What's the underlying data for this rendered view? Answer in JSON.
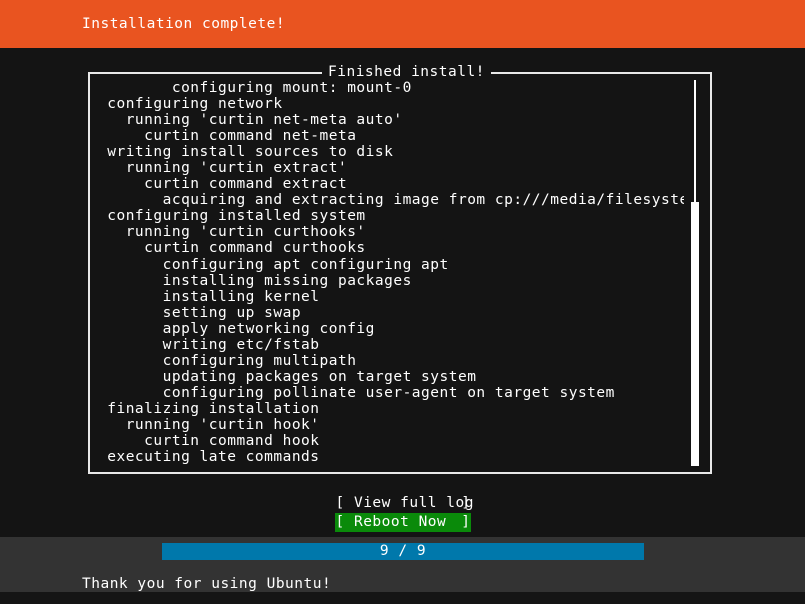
{
  "header": {
    "title": "Installation complete!",
    "background_color": "#e95420",
    "text_color": "#ffffff"
  },
  "log_panel": {
    "box_title": "Finished install!",
    "border_color": "#e8e8e8",
    "lines": [
      "        configuring mount: mount-0",
      " configuring network",
      "   running 'curtin net-meta auto'",
      "     curtin command net-meta",
      " writing install sources to disk",
      "   running 'curtin extract'",
      "     curtin command extract",
      "       acquiring and extracting image from cp:///media/filesystem",
      " configuring installed system",
      "   running 'curtin curthooks'",
      "     curtin command curthooks",
      "       configuring apt configuring apt",
      "       installing missing packages",
      "       installing kernel",
      "       setting up swap",
      "       apply networking config",
      "       writing etc/fstab",
      "       configuring multipath",
      "       updating packages on target system",
      "       configuring pollinate user-agent on target system",
      " finalizing installation",
      "   running 'curtin hook'",
      "     curtin command hook",
      " executing late commands"
    ],
    "scrollbar": {
      "name": "vertical-scrollbar",
      "thumb_color": "#ffffff"
    }
  },
  "buttons": [
    {
      "label_open": "[ View full log",
      "label_close": "]",
      "name": "view-full-log-button",
      "selected": false
    },
    {
      "label_open": "[ Reboot Now",
      "label_close": "]",
      "name": "reboot-now-button",
      "selected": true,
      "highlight_color": "#0a8a0a"
    }
  ],
  "progress": {
    "label": "9 / 9",
    "current": 9,
    "total": 9,
    "percent": 100,
    "fill_color": "#0078ab"
  },
  "footer": {
    "message": "Thank you for using Ubuntu!",
    "background_color": "#333333"
  }
}
